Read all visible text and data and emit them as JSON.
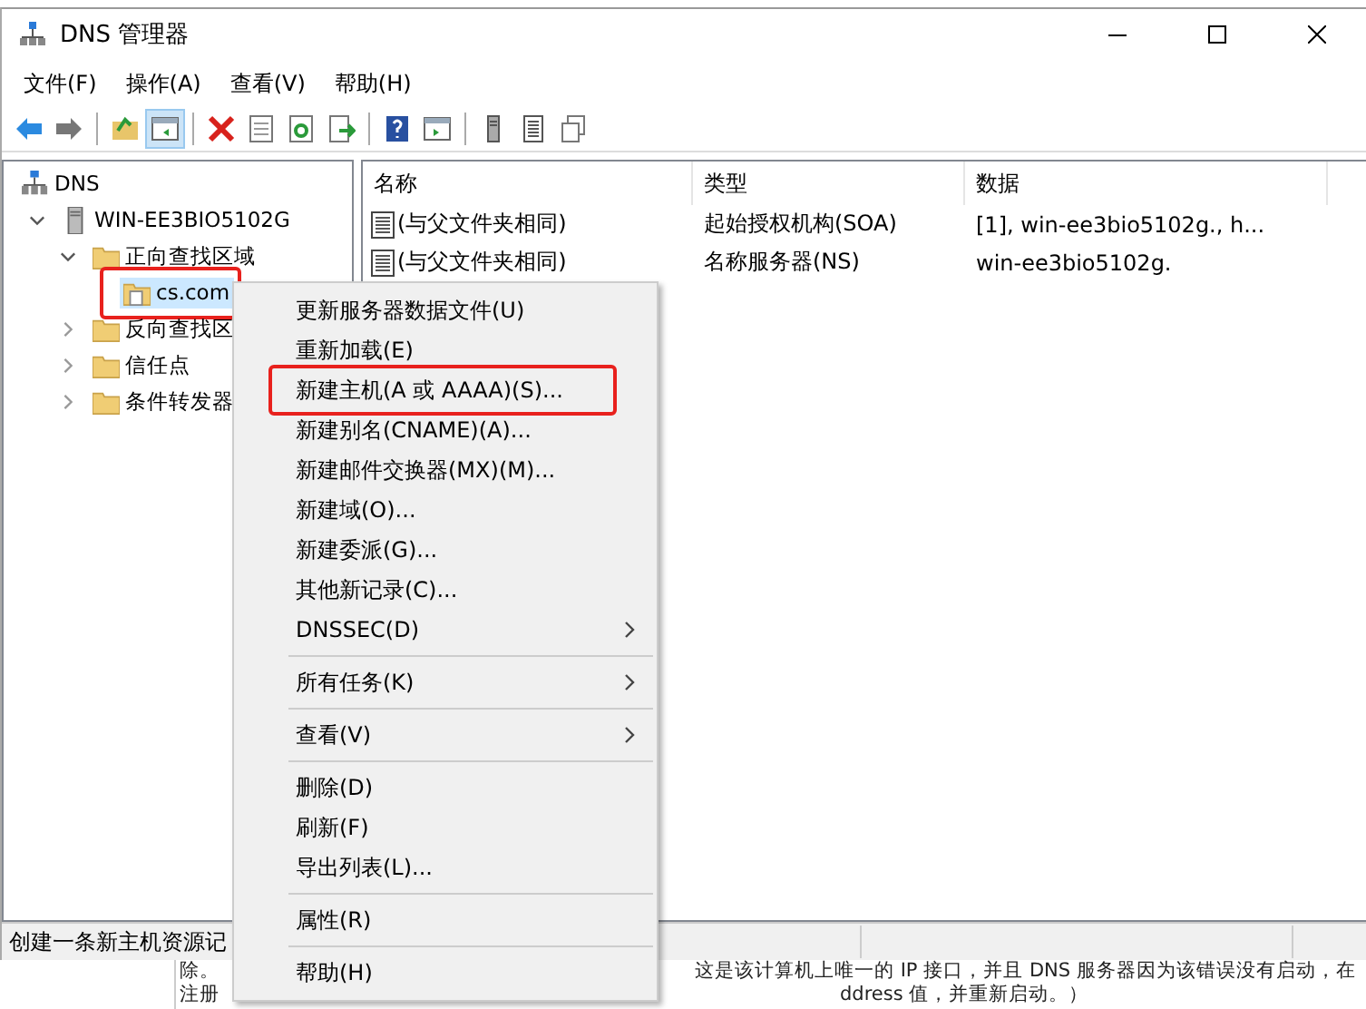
{
  "window": {
    "title": "DNS 管理器"
  },
  "menu": [
    "文件(F)",
    "操作(A)",
    "查看(V)",
    "帮助(H)"
  ],
  "toolbar": [
    {
      "kind": "back",
      "pressed": false
    },
    {
      "kind": "forward",
      "pressed": false
    },
    {
      "kind": "sep"
    },
    {
      "kind": "up",
      "pressed": false
    },
    {
      "kind": "pane",
      "pressed": true
    },
    {
      "kind": "sep"
    },
    {
      "kind": "delete",
      "pressed": false
    },
    {
      "kind": "doc",
      "pressed": false
    },
    {
      "kind": "refresh",
      "pressed": false
    },
    {
      "kind": "export",
      "pressed": false
    },
    {
      "kind": "sep"
    },
    {
      "kind": "help",
      "pressed": false
    },
    {
      "kind": "pane2",
      "pressed": false
    },
    {
      "kind": "sep"
    },
    {
      "kind": "server",
      "pressed": false
    },
    {
      "kind": "list",
      "pressed": false
    },
    {
      "kind": "copy",
      "pressed": false
    }
  ],
  "tree": [
    {
      "label": "DNS",
      "kind": "root",
      "children": [
        {
          "label": "WIN-EE3BIO5102G",
          "kind": "server",
          "expanded": true,
          "children": [
            {
              "label": "正向查找区域",
              "kind": "folder",
              "expanded": true,
              "children": [
                {
                  "label": "cs.com",
                  "kind": "zone",
                  "selected": true
                }
              ]
            },
            {
              "label": "反向查找区",
              "kind": "folder",
              "expanded": false
            },
            {
              "label": "信任点",
              "kind": "folder",
              "expanded": false
            },
            {
              "label": "条件转发器",
              "kind": "folder",
              "expanded": false
            }
          ]
        }
      ]
    }
  ],
  "table": {
    "columns": [
      "名称",
      "类型",
      "数据"
    ],
    "rows": [
      [
        "(与父文件夹相同)",
        "起始授权机构(SOA)",
        "[1], win-ee3bio5102g., h..."
      ],
      [
        "(与父文件夹相同)",
        "名称服务器(NS)",
        "win-ee3bio5102g."
      ]
    ]
  },
  "context_menu": [
    {
      "kind": "item",
      "label": "更新服务器数据文件(U)"
    },
    {
      "kind": "item",
      "label": "重新加载(E)"
    },
    {
      "kind": "item",
      "label": "新建主机(A 或 AAAA)(S)...",
      "highlighted": true
    },
    {
      "kind": "item",
      "label": "新建别名(CNAME)(A)..."
    },
    {
      "kind": "item",
      "label": "新建邮件交换器(MX)(M)..."
    },
    {
      "kind": "item",
      "label": "新建域(O)..."
    },
    {
      "kind": "item",
      "label": "新建委派(G)..."
    },
    {
      "kind": "item",
      "label": "其他新记录(C)..."
    },
    {
      "kind": "submenu",
      "label": "DNSSEC(D)"
    },
    {
      "kind": "sep"
    },
    {
      "kind": "submenu",
      "label": "所有任务(K)"
    },
    {
      "kind": "sep"
    },
    {
      "kind": "submenu",
      "label": "查看(V)"
    },
    {
      "kind": "sep"
    },
    {
      "kind": "item",
      "label": "删除(D)"
    },
    {
      "kind": "item",
      "label": "刷新(F)"
    },
    {
      "kind": "item",
      "label": "导出列表(L)..."
    },
    {
      "kind": "sep"
    },
    {
      "kind": "item",
      "label": "属性(R)"
    },
    {
      "kind": "sep"
    },
    {
      "kind": "item",
      "label": "帮助(H)"
    }
  ],
  "status_bar": "创建一条新主机资源记",
  "background_window": {
    "line_1_left": "除。",
    "line_1_right": "这是该计算机上唯一的 IP 接口，并且 DNS 服务器因为该错误没有启动，在",
    "line_2_left": "注册",
    "line_2_right": "ddress 值，并重新启动。）"
  }
}
